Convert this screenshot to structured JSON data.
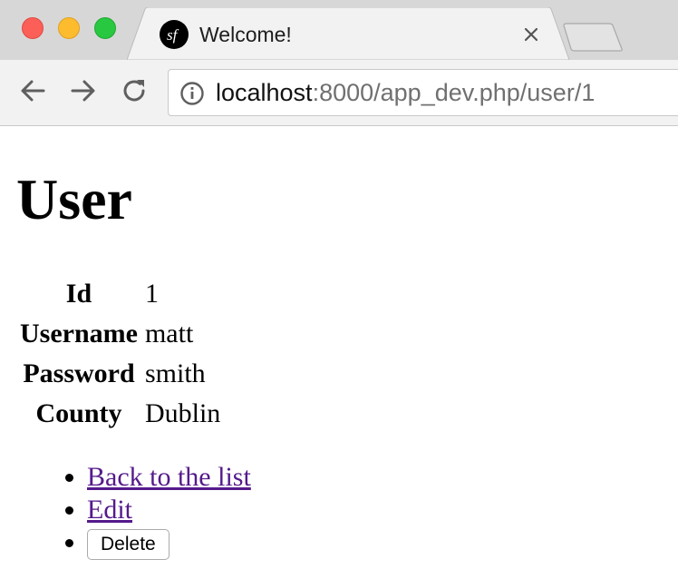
{
  "browser": {
    "tab_title": "Welcome!",
    "url_host": "localhost",
    "url_rest": ":8000/app_dev.php/user/1",
    "icons": {
      "close": "close-icon",
      "favicon": "symfony-logo-icon",
      "back": "back-arrow-icon",
      "forward": "forward-arrow-icon",
      "reload": "reload-icon",
      "info": "info-icon"
    }
  },
  "page": {
    "title": "User",
    "fields": [
      {
        "label": "Id",
        "value": "1"
      },
      {
        "label": "Username",
        "value": "matt"
      },
      {
        "label": "Password",
        "value": "smith"
      },
      {
        "label": "County",
        "value": "Dublin"
      }
    ],
    "actions": {
      "back_label": "Back to the list",
      "edit_label": "Edit",
      "delete_label": "Delete"
    },
    "colors": {
      "link": "#551a8b"
    }
  }
}
